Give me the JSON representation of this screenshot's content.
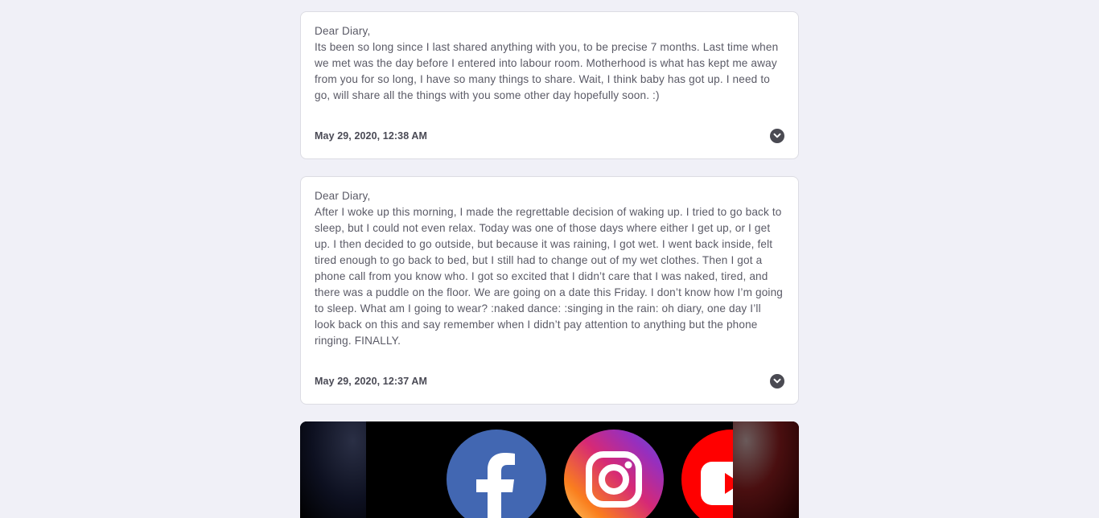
{
  "posts": [
    {
      "body": "Dear Diary,\nIts been so long since I last shared anything with you, to be precise 7 months. Last time when we met was the day before I entered into labour room. Motherhood is what has kept me away from you for so long, I have so many things to share. Wait, I think baby has got up. I need to go, will share all the things with you some other day hopefully soon. :)",
      "date": "May 29, 2020, 12:38 AM"
    },
    {
      "body": "Dear Diary,\nAfter I woke up this morning, I made the regrettable decision of waking up. I tried to go back to sleep, but I could not even relax. Today was one of those days where either I get up, or I get up. I then decided to go outside, but because it was raining, I got wet. I went back inside, felt tired enough to go back to bed, but I still had to change out of my wet clothes. Then I got a phone call from you know who. I got so excited that I didn’t care that I was naked, tired, and there was a puddle on the floor. We are going on a date this Friday. I don’t know how I’m going to sleep. What am I going to wear? :naked dance: :singing in the rain: oh diary, one day I’ll look back on this and say remember when I didn’t pay attention to anything but the phone ringing. FINALLY.",
      "date": "May 29, 2020, 12:37 AM"
    }
  ],
  "icons": {
    "expand": "chevron-down-icon",
    "logos": [
      "facebook-logo",
      "instagram-logo",
      "youtube-logo"
    ]
  },
  "colors": {
    "background": "#f0f0f7",
    "card": "#ffffff",
    "text": "#5a5a66",
    "facebook": "#4267b2",
    "youtube": "#ff0000"
  }
}
